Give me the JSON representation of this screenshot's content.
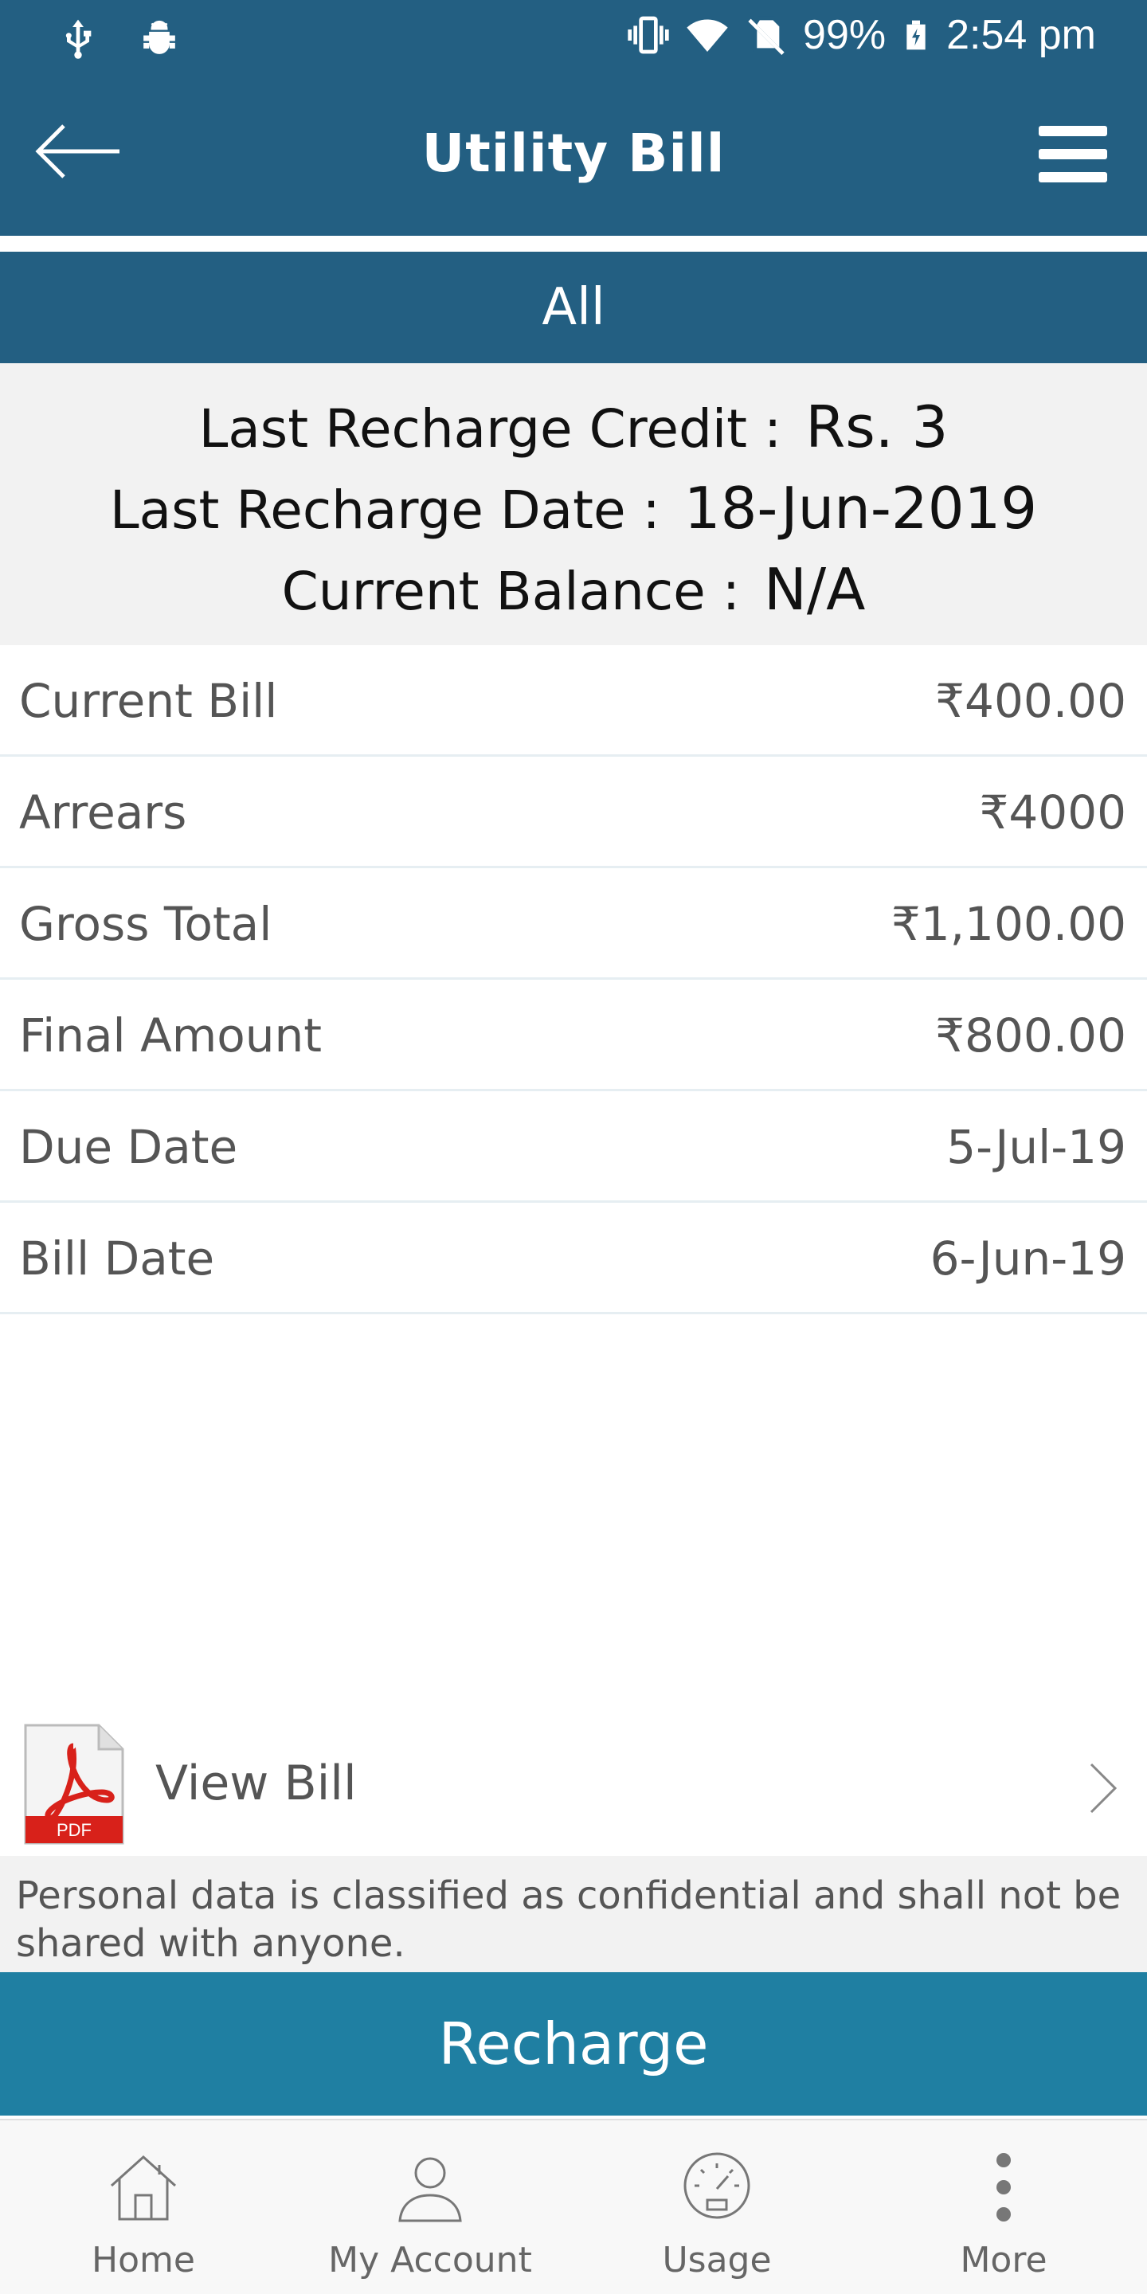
{
  "status_bar": {
    "battery": "99%",
    "time": "2:54 pm",
    "icons": [
      "usb-icon",
      "android-debug-icon",
      "vibrate-icon",
      "wifi-icon",
      "no-sim-icon",
      "battery-charging-icon"
    ]
  },
  "app_bar": {
    "title": "Utility Bill",
    "back_icon": "arrow-left-icon",
    "menu_icon": "hamburger-menu-icon"
  },
  "filter": {
    "label": "All"
  },
  "recharge_info": {
    "credit_label": "Last Recharge Credit :",
    "credit_value": "Rs. 3",
    "date_label": "Last Recharge Date :",
    "date_value": "18-Jun-2019",
    "balance_label": "Current Balance :",
    "balance_value": "N/A"
  },
  "bill_rows": [
    {
      "label": "Current Bill",
      "value": "₹400.00"
    },
    {
      "label": "Arrears",
      "value": "₹4000"
    },
    {
      "label": "Gross Total",
      "value": "₹1,100.00"
    },
    {
      "label": "Final Amount",
      "value": "₹800.00"
    },
    {
      "label": "Due Date",
      "value": "5-Jul-19"
    },
    {
      "label": "Bill Date",
      "value": "6-Jun-19"
    }
  ],
  "view_bill": {
    "label": "View Bill",
    "pdf_badge": "PDF"
  },
  "privacy_note": "Personal data is classified as confidential and shall not be shared with anyone.",
  "recharge_button": "Recharge",
  "bottom_nav": [
    {
      "label": "Home",
      "icon": "home-icon"
    },
    {
      "label": "My Account",
      "icon": "user-icon"
    },
    {
      "label": "Usage",
      "icon": "speedometer-icon"
    },
    {
      "label": "More",
      "icon": "more-vertical-icon"
    }
  ],
  "colors": {
    "primary": "#235f82",
    "accent_button": "#1f7fa2",
    "info_background": "#f2f2f2",
    "pdf_red": "#d8211a"
  }
}
